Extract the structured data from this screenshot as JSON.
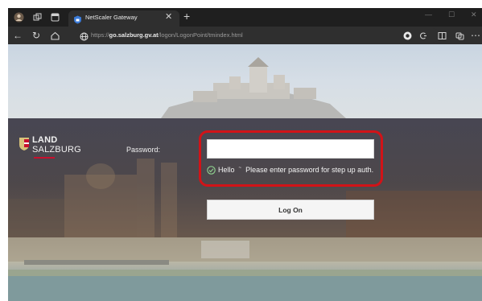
{
  "browser": {
    "tab": {
      "title": "NetScaler Gateway"
    },
    "address_bar": {
      "url_prefix": "https://",
      "url_domain": "go.salzburg.gv.at",
      "url_path": "/logon/LogonPoint/tmindex.html"
    }
  },
  "logo": {
    "line1": "LAND",
    "line2": "SALZBURG"
  },
  "login": {
    "password_label": "Password:",
    "password_value": "",
    "hint_prefix": "Hello",
    "hint_text": "Please enter password for step up auth.",
    "button_label": "Log On"
  },
  "colors": {
    "accent_red": "#d11318",
    "hint_check": "#8fd18f"
  }
}
